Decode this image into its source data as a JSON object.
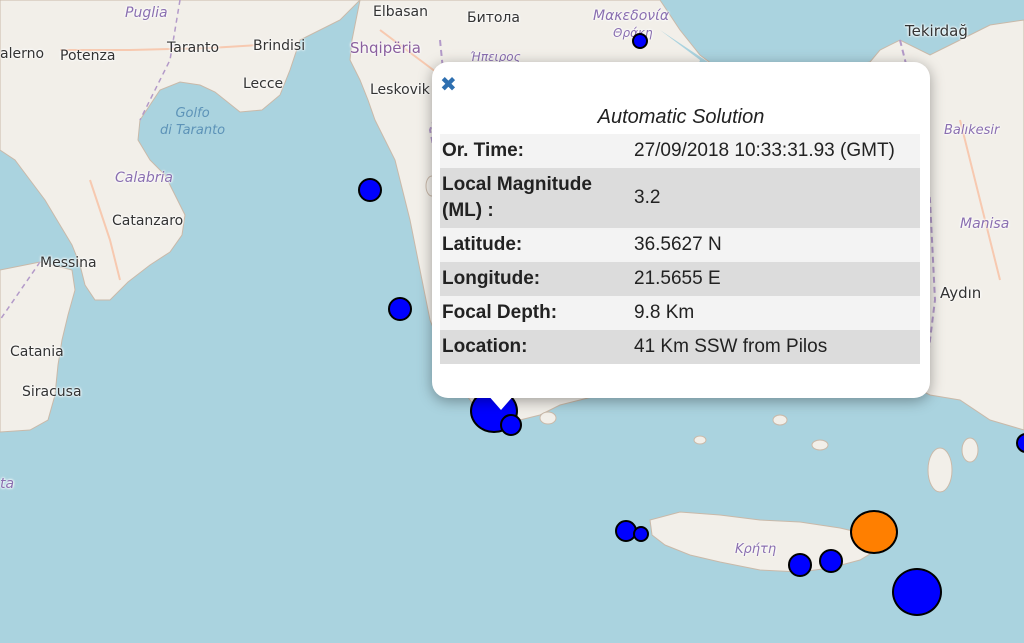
{
  "map": {
    "places": [
      {
        "name": "Puglia",
        "style": "region"
      },
      {
        "name": "alerno",
        "style": "normal"
      },
      {
        "name": "Potenza",
        "style": "normal"
      },
      {
        "name": "Taranto",
        "style": "normal"
      },
      {
        "name": "Brindisi",
        "style": "normal"
      },
      {
        "name": "Lecce",
        "style": "normal"
      },
      {
        "name": "Golfo\ndi Taranto",
        "style": "sea"
      },
      {
        "name": "Calabria",
        "style": "region"
      },
      {
        "name": "Catanzaro",
        "style": "normal"
      },
      {
        "name": "Messina",
        "style": "normal"
      },
      {
        "name": "Catania",
        "style": "normal"
      },
      {
        "name": "Siracusa",
        "style": "normal"
      },
      {
        "name": "ta",
        "style": "region"
      },
      {
        "name": "Elbasan",
        "style": "normal"
      },
      {
        "name": "Битола",
        "style": "normal"
      },
      {
        "name": "Μακεδονία",
        "style": "greek"
      },
      {
        "name": "Θράκη",
        "style": "greek"
      },
      {
        "name": "Shqipëria",
        "style": "country"
      },
      {
        "name": "Ήπειρος",
        "style": "greek"
      },
      {
        "name": "Leskovik",
        "style": "normal"
      },
      {
        "name": "Tekirdağ",
        "style": "normal"
      },
      {
        "name": "Balıkesir",
        "style": "region"
      },
      {
        "name": "Manisa",
        "style": "region"
      },
      {
        "name": "Aydın",
        "style": "normal"
      },
      {
        "name": "Κρήτη",
        "style": "greek"
      }
    ],
    "quake_color_default": "#0000ff",
    "quake_color_selected": "#ff7f00"
  },
  "popup": {
    "title": "Automatic Solution",
    "rows": [
      {
        "label": "Or. Time:",
        "value": "27/09/2018 10:33:31.93 (GMT)"
      },
      {
        "label": "Local Magnitude (ML) :",
        "value": "3.2"
      },
      {
        "label": "Latitude:",
        "value": "36.5627 N"
      },
      {
        "label": "Longitude:",
        "value": "21.5655 E"
      },
      {
        "label": "Focal Depth:",
        "value": "9.8 Km"
      },
      {
        "label": "Location:",
        "value": "41 Km SSW from Pilos"
      }
    ]
  }
}
